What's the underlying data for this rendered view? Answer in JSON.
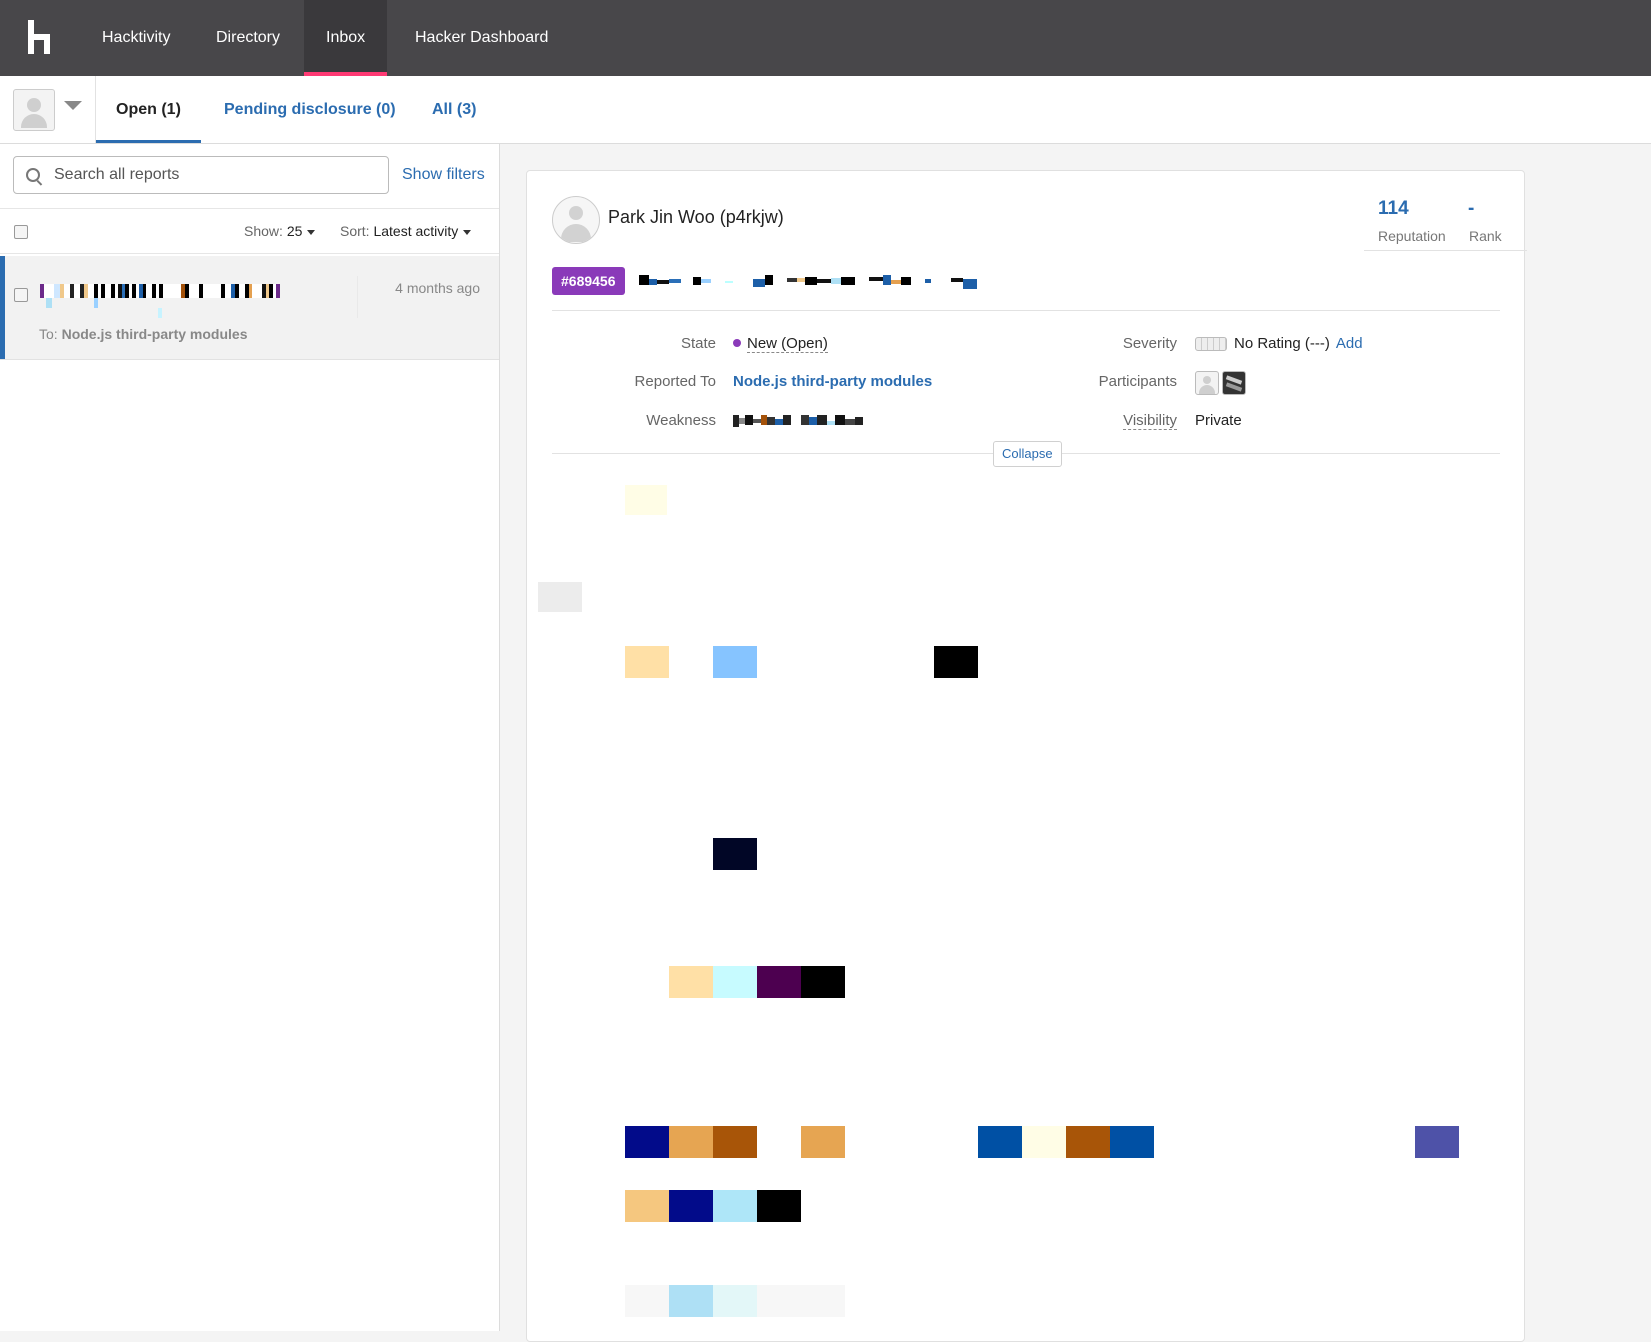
{
  "nav": {
    "items": [
      "Hacktivity",
      "Directory",
      "Inbox",
      "Hacker Dashboard"
    ],
    "active": "Inbox"
  },
  "tabs": {
    "open": "Open  (1)",
    "pending": "Pending disclosure  (0)",
    "all": "All  (3)"
  },
  "list": {
    "search_placeholder": "Search all reports",
    "show_filters": "Show filters",
    "show_label": "Show:",
    "show_value": "25",
    "sort_label": "Sort:",
    "sort_value": "Latest activity",
    "report": {
      "time": "4 months ago",
      "to_prefix": "To:",
      "to_program": "Node.js third-party modules"
    }
  },
  "report": {
    "reporter": "Park Jin Woo (p4rkjw)",
    "reputation_value": "114",
    "reputation_label": "Reputation",
    "rank_value": "-",
    "rank_label": "Rank",
    "id_badge": "#689456",
    "fields": {
      "state_label": "State",
      "state_value": "New (Open)",
      "reported_to_label": "Reported To",
      "reported_to_value": "Node.js third-party modules",
      "weakness_label": "Weakness",
      "severity_label": "Severity",
      "severity_value": "No Rating (---)",
      "severity_add": "Add",
      "participants_label": "Participants",
      "visibility_label": "Visibility",
      "visibility_value": "Private"
    },
    "collapse": "Collapse"
  },
  "colors": {
    "topbar": "#48474a",
    "accent_pink": "#ff3a74",
    "link_blue": "#2b6cb0",
    "badge_purple": "#8a3ab9"
  }
}
